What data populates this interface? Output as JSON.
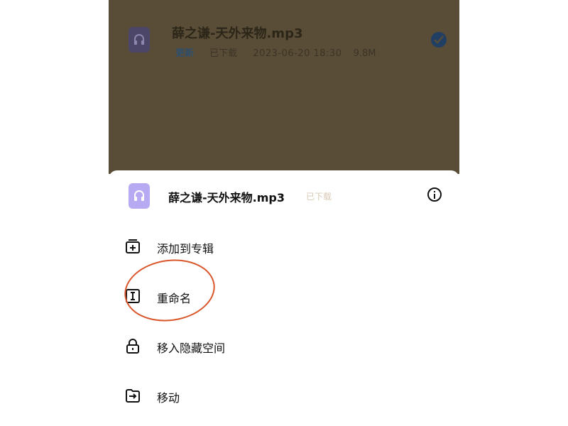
{
  "background_file": {
    "name": "薛之谦-天外来物.mp3",
    "badge": "更新",
    "status": "已下载",
    "date": "2023-06-20 18:30",
    "size": "9.8M",
    "icon": "headphones-icon",
    "selected": true
  },
  "sheet": {
    "title": "薛之谦-天外来物.mp3",
    "status": "已下载",
    "icon": "headphones-icon",
    "info_icon": "info-icon",
    "items": [
      {
        "label": "添加到专辑",
        "icon": "add-to-album-icon"
      },
      {
        "label": "重命名",
        "icon": "rename-icon"
      },
      {
        "label": "移入隐藏空间",
        "icon": "lock-icon"
      },
      {
        "label": "移动",
        "icon": "move-folder-icon"
      }
    ]
  },
  "colors": {
    "backdrop": "#5a4d37",
    "accent_purple": "#b7a9f2",
    "check_blue": "#213f63",
    "annotation_red": "#d9552a"
  }
}
